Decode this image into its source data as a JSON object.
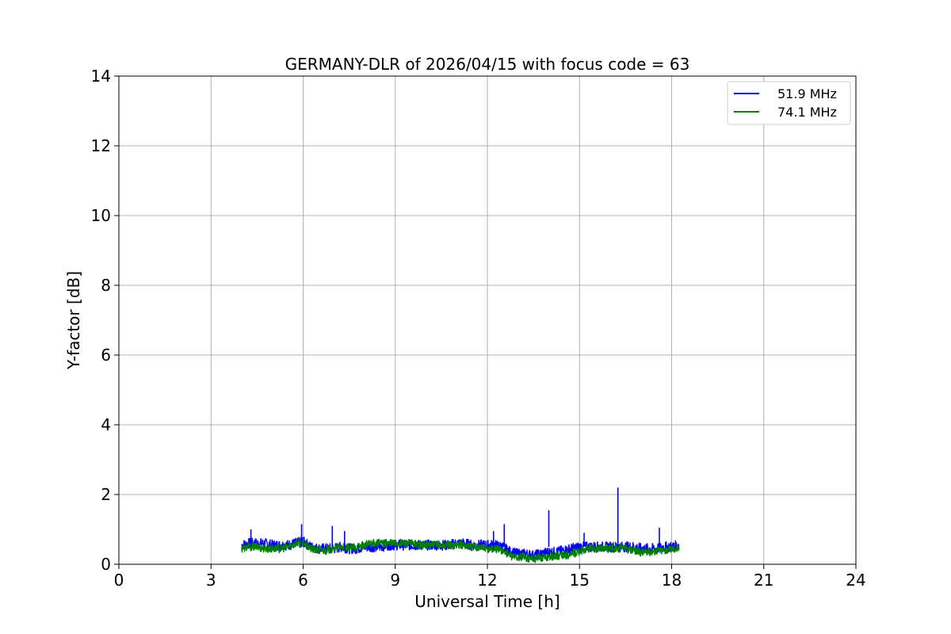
{
  "chart_data": {
    "type": "line",
    "title": "GERMANY-DLR of 2026/04/15 with focus code = 63",
    "xlabel": "Universal Time [h]",
    "ylabel": "Y-factor [dB]",
    "xlim": [
      0,
      24
    ],
    "ylim": [
      0,
      14
    ],
    "xticks": [
      0,
      3,
      6,
      9,
      12,
      15,
      18,
      21,
      24
    ],
    "yticks": [
      0,
      2,
      4,
      6,
      8,
      10,
      12,
      14
    ],
    "grid": true,
    "legend_position": "top-right",
    "series": [
      {
        "name": "51.9 MHz",
        "color": "#0000ff",
        "x": [
          4.0,
          4.25,
          4.5,
          4.75,
          5.0,
          5.25,
          5.5,
          5.75,
          6.0,
          6.25,
          6.5,
          6.75,
          7.0,
          7.25,
          7.5,
          7.75,
          8.0,
          8.25,
          8.5,
          8.75,
          9.0,
          9.25,
          9.5,
          9.75,
          10.0,
          10.25,
          10.5,
          10.75,
          11.0,
          11.25,
          11.5,
          11.75,
          12.0,
          12.25,
          12.5,
          12.75,
          13.0,
          13.25,
          13.5,
          13.75,
          14.0,
          14.25,
          14.5,
          14.75,
          15.0,
          15.25,
          15.5,
          15.75,
          16.0,
          16.25,
          16.5,
          16.75,
          17.0,
          17.25,
          17.5,
          17.75,
          18.0,
          18.25
        ],
        "y": [
          0.55,
          0.6,
          0.6,
          0.6,
          0.55,
          0.55,
          0.55,
          0.6,
          0.65,
          0.5,
          0.45,
          0.45,
          0.45,
          0.5,
          0.45,
          0.45,
          0.5,
          0.5,
          0.5,
          0.55,
          0.55,
          0.55,
          0.55,
          0.55,
          0.55,
          0.55,
          0.55,
          0.55,
          0.6,
          0.6,
          0.55,
          0.55,
          0.55,
          0.55,
          0.5,
          0.35,
          0.3,
          0.3,
          0.25,
          0.3,
          0.35,
          0.35,
          0.4,
          0.45,
          0.5,
          0.5,
          0.5,
          0.5,
          0.5,
          0.5,
          0.5,
          0.5,
          0.45,
          0.45,
          0.45,
          0.5,
          0.5,
          0.55
        ]
      },
      {
        "name": "74.1 MHz",
        "color": "#008000",
        "x": [
          4.0,
          4.25,
          4.5,
          4.75,
          5.0,
          5.25,
          5.5,
          5.75,
          6.0,
          6.25,
          6.5,
          6.75,
          7.0,
          7.25,
          7.5,
          7.75,
          8.0,
          8.25,
          8.5,
          8.75,
          9.0,
          9.25,
          9.5,
          9.75,
          10.0,
          10.25,
          10.5,
          10.75,
          11.0,
          11.25,
          11.5,
          11.75,
          12.0,
          12.25,
          12.5,
          12.75,
          13.0,
          13.25,
          13.5,
          13.75,
          14.0,
          14.25,
          14.5,
          14.75,
          15.0,
          15.25,
          15.5,
          15.75,
          16.0,
          16.25,
          16.5,
          16.75,
          17.0,
          17.25,
          17.5,
          17.75,
          18.0,
          18.25
        ],
        "y": [
          0.45,
          0.5,
          0.5,
          0.45,
          0.45,
          0.45,
          0.5,
          0.6,
          0.6,
          0.45,
          0.4,
          0.4,
          0.45,
          0.5,
          0.45,
          0.5,
          0.55,
          0.6,
          0.6,
          0.6,
          0.6,
          0.6,
          0.6,
          0.55,
          0.55,
          0.55,
          0.55,
          0.55,
          0.55,
          0.55,
          0.5,
          0.5,
          0.45,
          0.45,
          0.4,
          0.25,
          0.2,
          0.2,
          0.15,
          0.2,
          0.2,
          0.25,
          0.25,
          0.3,
          0.35,
          0.45,
          0.45,
          0.45,
          0.45,
          0.45,
          0.45,
          0.4,
          0.35,
          0.35,
          0.4,
          0.4,
          0.45,
          0.45
        ]
      }
    ]
  }
}
